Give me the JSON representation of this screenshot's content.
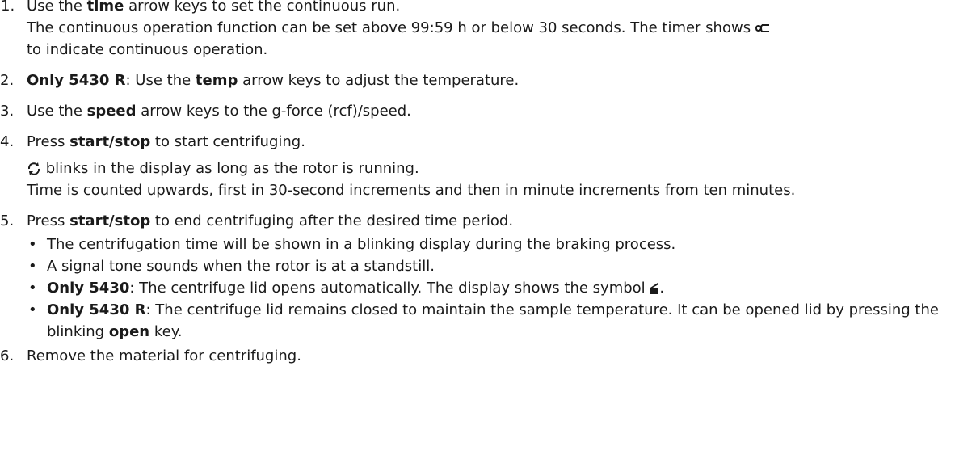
{
  "steps": [
    {
      "num": "1.",
      "pre": "Use the ",
      "bold": "time",
      "post": " arrow keys to set the continuous run.",
      "detail_pre": "The continuous operation function can be set above 99:59 h or below 30 seconds. The timer shows ",
      "detail_icon": "continuous-operation-symbol",
      "detail_post": "to indicate continuous operation."
    },
    {
      "num": "2.",
      "bold1": "Only 5430 R",
      "mid": ": Use the ",
      "bold2": "temp",
      "post": " arrow keys to adjust the temperature."
    },
    {
      "num": "3.",
      "pre": "Use the ",
      "bold": "speed",
      "post": " arrow keys to the g-force (rcf)/speed."
    },
    {
      "num": "4.",
      "pre": "Press ",
      "bold": "start/stop",
      "post": " to start centrifuging.",
      "line2_icon": "rotation-icon",
      "line2": " blinks in the display as long as the rotor is running.",
      "line3": "Time is counted upwards, first in 30-second increments and then in minute increments from ten minutes."
    },
    {
      "num": "5.",
      "pre": "Press ",
      "bold": "start/stop",
      "post": " to end centrifuging after the desired time period.",
      "bullets": [
        {
          "text": "The centrifugation time will be shown in a blinking display during the braking process."
        },
        {
          "text": "A signal tone sounds when the rotor is at a standstill."
        },
        {
          "bold": "Only 5430",
          "text": ": The centrifuge lid opens automatically. The display shows the symbol ",
          "icon": "lid-open-icon",
          "tail": "."
        },
        {
          "bold": "Only 5430 R",
          "text": ": The centrifuge lid remains closed to maintain the sample temperature. It can be opened lid by pressing the blinking ",
          "bold2": "open",
          "tail": " key."
        }
      ]
    },
    {
      "num": "6.",
      "text": "Remove the material for centrifuging."
    }
  ],
  "bullet_glyph": "•"
}
